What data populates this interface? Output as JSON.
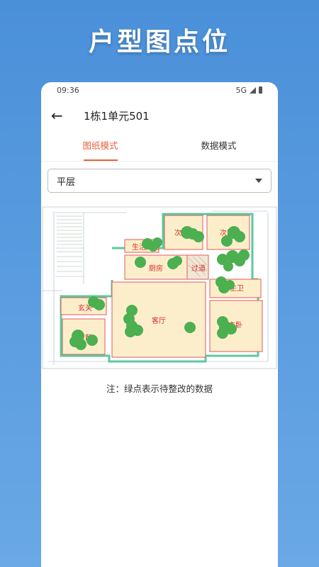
{
  "headline": "户型图点位",
  "status": {
    "time": "09:36",
    "network": "5G"
  },
  "appbar": {
    "title": "1栋1单元501"
  },
  "tabs": [
    {
      "label": "图纸模式",
      "active": true
    },
    {
      "label": "数据模式",
      "active": false
    }
  ],
  "floor_select": {
    "value": "平层"
  },
  "floorplan": {
    "rooms": [
      "次卧",
      "次卧",
      "生活阳台",
      "厨房",
      "过道",
      "主卫",
      "玄关",
      "客厅",
      "主卧",
      "次卧"
    ],
    "marker_color": "#4caf50",
    "room_label_color": "#d32f2f",
    "room_fill": "#fdeecb",
    "marker_meaning": "待整改"
  },
  "note": "注：绿点表示待整改的数据",
  "colors": {
    "accent": "#e8633a",
    "background": "#4a90d9"
  }
}
